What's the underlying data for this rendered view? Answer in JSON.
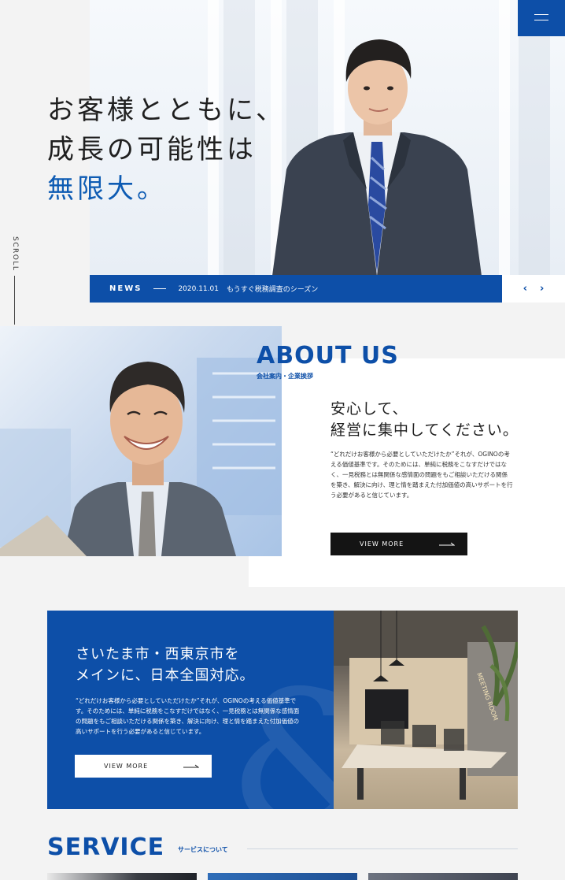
{
  "hero": {
    "line1": "お客様とともに、",
    "line2": "成長の可能性は",
    "line3": "無限大。"
  },
  "scroll": {
    "label": "SCROLL"
  },
  "news": {
    "tag": "NEWS",
    "date": "2020.11.01",
    "text": "もうすぐ税務調査のシーズン",
    "prev": "‹",
    "next": "›"
  },
  "about": {
    "title": "ABOUT US",
    "subtitle": "会社案内・企業挨拶",
    "heading_line1": "安心して、",
    "heading_line2": "経営に集中してください。",
    "body": "“どれだけお客様から必要としていただけたか”それが、OGINOの考える価値基準です。そのためには、単純に税務をこなすだけではなく、一見税務とは無関係な感情面の問題をもご相談いただける関係を築き、解決に向け、理と情を踏まえた付加価値の高いサポートを行う必要があると信じています。",
    "button": "VIEW MORE"
  },
  "area": {
    "heading_line1": "さいたま市・西東京市を",
    "heading_line2": "メインに、日本全国対応。",
    "body": "“どれだけお客様から必要としていただけたか”それが、OGINOの考える価値基準です。そのためには、単純に税務をこなすだけではなく、一見税務とは無関係な感情面の問題をもご相談いただける関係を築き、解決に向け、理と情を踏まえた付加価値の高いサポートを行う必要があると信じています。",
    "button": "VIEW MORE",
    "photo_sign": "MEETING ROOM"
  },
  "service": {
    "title": "SERVICE",
    "subtitle": "サービスについて"
  },
  "colors": {
    "brand": "#0d4fa8",
    "dark": "#141414",
    "bg": "#f3f3f3"
  }
}
